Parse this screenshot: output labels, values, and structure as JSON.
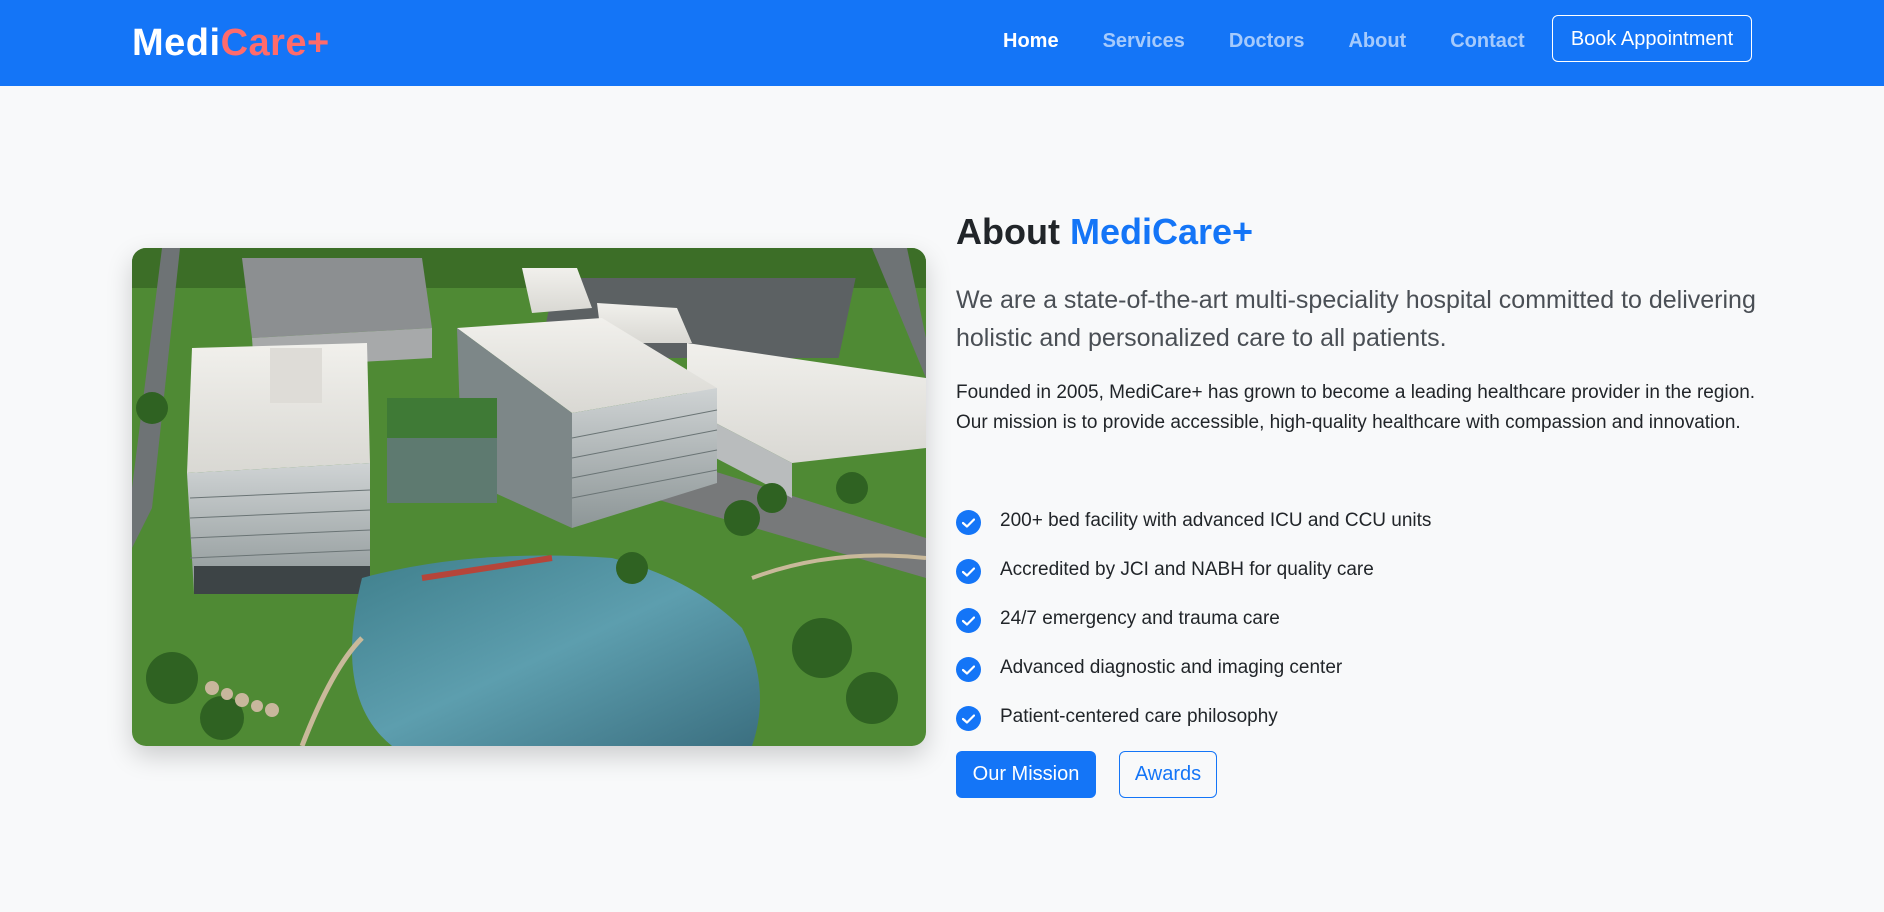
{
  "nav": {
    "brand_part1": "Medi",
    "brand_part2": "Care+",
    "links": [
      "Home",
      "Services",
      "Doctors",
      "About",
      "Contact"
    ],
    "active_link": "Home",
    "cta_label": "Book Appointment"
  },
  "about": {
    "title_prefix": "About",
    "title_accent": "MediCare+",
    "lead": "We are a state-of-the-art multi-speciality hospital committed to delivering holistic and personalized care to all patients.",
    "description": "Founded in 2005, MediCare+ has grown to become a leading healthcare provider in the region. Our mission is to provide accessible, high-quality healthcare with compassion and innovation.",
    "features": [
      "200+ bed facility with advanced ICU and CCU units",
      "Accredited by JCI and NABH for quality care",
      "24/7 emergency and trauma care",
      "Advanced diagnostic and imaging center",
      "Patient-centered care philosophy"
    ],
    "primary_button": "Our Mission",
    "secondary_button": "Awards"
  },
  "colors": {
    "primary": "#1475f7",
    "brand_accent": "#ff6b6b",
    "background": "#f8f9fa"
  },
  "icons": {
    "feature_icon": "check-circle-icon"
  }
}
